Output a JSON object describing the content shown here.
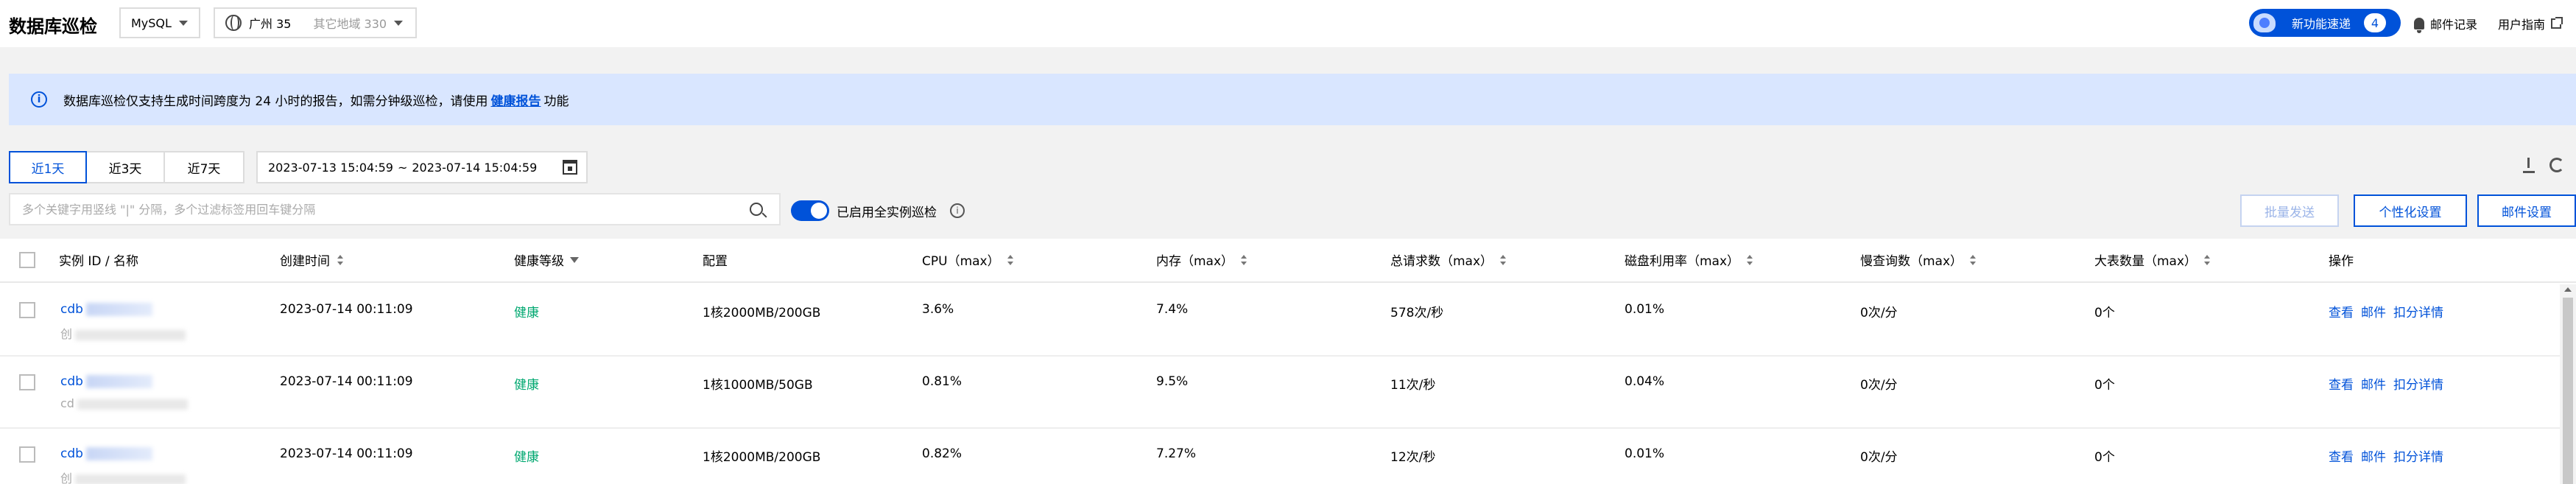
{
  "header": {
    "title": "数据库巡检",
    "db_type": "MySQL",
    "region": "广州 35",
    "other_region": "其它地域 330",
    "new_features_label": "新功能速递",
    "new_features_count": "4",
    "mail_records": "邮件记录",
    "user_guide": "用户指南"
  },
  "banner": {
    "text_before": "数据库巡检仅支持生成时间跨度为 24 小时的报告，如需分钟级巡检，请使用",
    "link": "健康报告",
    "text_after": "功能"
  },
  "toolbar": {
    "ranges": [
      "近1天",
      "近3天",
      "近7天"
    ],
    "active_range": "近1天",
    "date_start": "2023-07-13 15:04:59",
    "date_sep": "~",
    "date_end": "2023-07-14 15:04:59",
    "search_placeholder": "多个关键字用竖线 \"|\" 分隔，多个过滤标签用回车键分隔",
    "toggle_on": true,
    "toggle_label": "已启用全实例巡检",
    "batch_send": "批量发送",
    "personalize": "个性化设置",
    "mail_settings": "邮件设置"
  },
  "table": {
    "columns": [
      "实例 ID / 名称",
      "创建时间",
      "健康等级",
      "配置",
      "CPU（max）",
      "内存（max）",
      "总请求数（max）",
      "磁盘利用率（max）",
      "慢查询数（max）",
      "大表数量（max）",
      "操作"
    ],
    "actions": [
      "查看",
      "邮件",
      "扣分详情"
    ],
    "rows": [
      {
        "id_prefix": "cdb",
        "sub_prefix": "创",
        "created": "2023-07-14 00:11:09",
        "health": "健康",
        "config": "1核2000MB/200GB",
        "cpu": "3.6%",
        "mem": "7.4%",
        "requests": "578次/秒",
        "disk": "0.01%",
        "slow": "0次/分",
        "big_tables": "0个"
      },
      {
        "id_prefix": "cdb",
        "sub_prefix": "cd",
        "created": "2023-07-14 00:11:09",
        "health": "健康",
        "config": "1核1000MB/50GB",
        "cpu": "0.81%",
        "mem": "9.5%",
        "requests": "11次/秒",
        "disk": "0.04%",
        "slow": "0次/分",
        "big_tables": "0个"
      },
      {
        "id_prefix": "cdb",
        "sub_prefix": "创",
        "created": "2023-07-14 00:11:09",
        "health": "健康",
        "config": "1核2000MB/200GB",
        "cpu": "0.82%",
        "mem": "7.27%",
        "requests": "12次/秒",
        "disk": "0.01%",
        "slow": "0次/分",
        "big_tables": "0个"
      }
    ]
  },
  "colors": {
    "primary": "#0052d9",
    "healthy": "#00a870",
    "banner_bg": "#d9e6ff"
  }
}
